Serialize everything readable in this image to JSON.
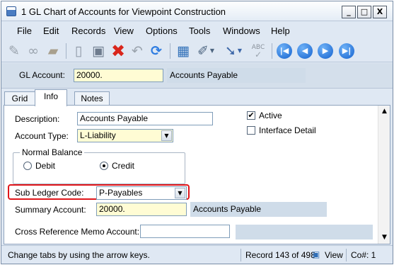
{
  "window": {
    "title": "1 GL Chart of Accounts for Viewpoint Construction",
    "buttons": {
      "minimize": "_",
      "maximize": "□",
      "close": "X"
    }
  },
  "menu": [
    "File",
    "Edit",
    "Records",
    "View",
    "Options",
    "Tools",
    "Windows",
    "Help"
  ],
  "toolbar": {
    "icons": [
      "notes-icon",
      "link-icon",
      "folder-icon",
      "new-record-icon",
      "save-icon",
      "delete-icon",
      "undo-icon",
      "refresh-icon",
      "calculator-icon",
      "attachment-icon",
      "scan-icon",
      "spellcheck-icon",
      "first-record-icon",
      "previous-record-icon",
      "next-record-icon",
      "last-record-icon"
    ],
    "spellcheck_text": "ABC"
  },
  "header": {
    "gl_account_label": "GL Account:",
    "gl_account_value": "20000.",
    "gl_account_description": "Accounts Payable"
  },
  "tabs": [
    "Grid",
    "Info",
    "Notes"
  ],
  "active_tab": "Info",
  "form": {
    "description_label": "Description:",
    "description_value": "Accounts Payable",
    "account_type_label": "Account Type:",
    "account_type_value": "L-Liability",
    "normal_balance_label": "Normal Balance",
    "debit_label": "Debit",
    "credit_label": "Credit",
    "normal_balance_selected": "Credit",
    "active_label": "Active",
    "active_checked": true,
    "interface_detail_label": "Interface Detail",
    "interface_detail_checked": false,
    "sub_ledger_label": "Sub Ledger Code:",
    "sub_ledger_value": "P-Payables",
    "summary_account_label": "Summary Account:",
    "summary_account_value": "20000.",
    "summary_account_description": "Accounts Payable",
    "cross_ref_label": "Cross Reference Memo Account:",
    "cross_ref_value": ""
  },
  "status": {
    "hint": "Change tabs by using the arrow keys.",
    "record": "Record 143 of 498",
    "view": "View",
    "company": "Co#: 1"
  },
  "colors": {
    "required_field": "#fffcd4",
    "highlight": "#e0161b",
    "nav_blue": "#1462cf",
    "delete_red": "#d9261c"
  }
}
